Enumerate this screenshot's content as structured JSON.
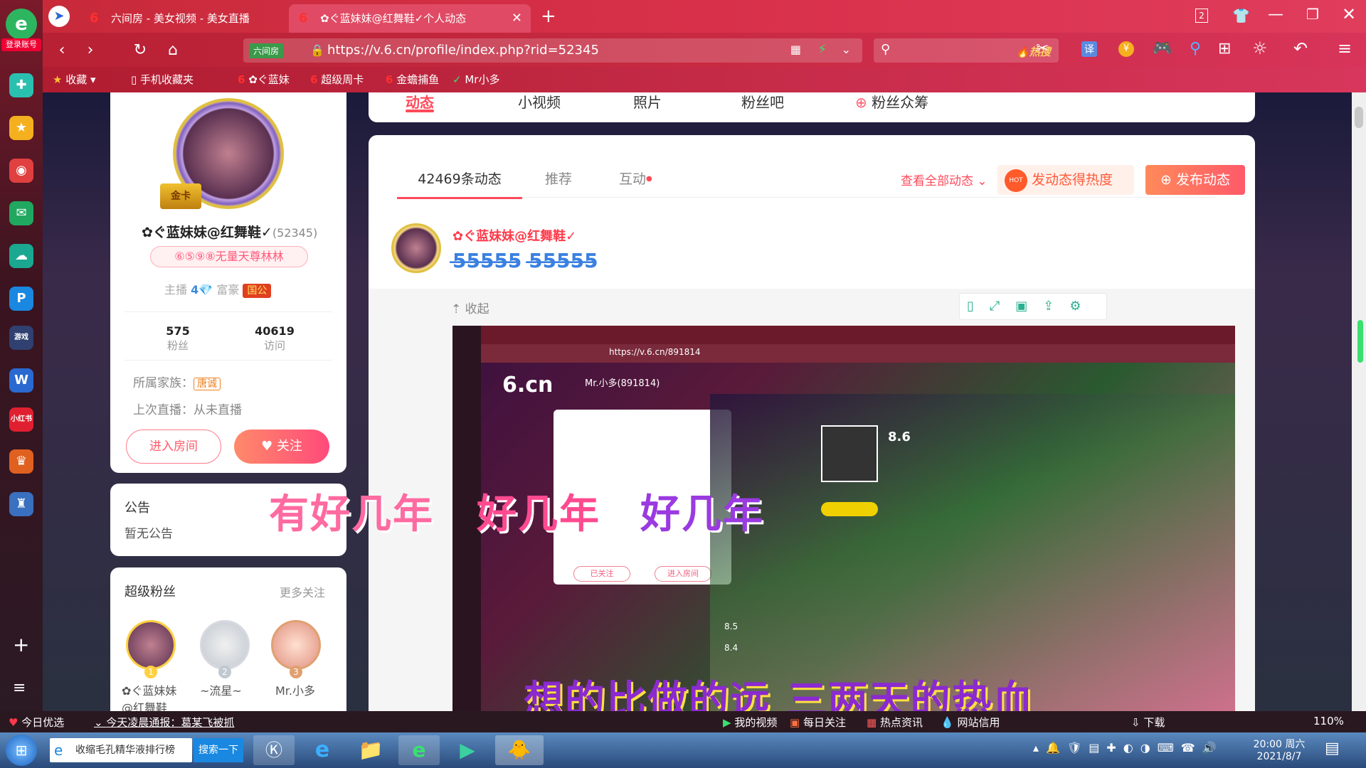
{
  "sidebar": {
    "login": "登录账号",
    "items": [
      "add-icon",
      "menu-icon"
    ]
  },
  "tabs": [
    {
      "label": "六间房 - 美女视频 - 美女直播",
      "active": false
    },
    {
      "label": "✿ぐ蓝妹妹@红舞鞋✓个人动态",
      "active": true
    }
  ],
  "address": {
    "tag": "六间房",
    "url": "https://v.6.cn/profile/index.php?rid=52345"
  },
  "search": {
    "hot": "热搜"
  },
  "toolbar": {
    "translate": "译"
  },
  "bookmarks": [
    "收藏",
    "手机收藏夹",
    "✿ぐ蓝妹",
    "超级周卡",
    "金蟾捕鱼",
    "Mr小多"
  ],
  "profile": {
    "name": "✿ぐ蓝妹妹@红舞鞋✓",
    "rid": "(52345)",
    "title": "⑥⑤⑨⑧无量天尊林林",
    "anchor_label": "主播",
    "anchor_level": "4",
    "rich_label": "富豪",
    "rich_badge": "国公",
    "fans_count": "575",
    "fans_label": "粉丝",
    "visits_count": "40619",
    "visits_label": "访问",
    "family_label": "所属家族：",
    "family": "唐诚",
    "last_live": "上次直播：从未直播",
    "enter_room": "进入房间",
    "follow": "关注",
    "frame_badge": "金卡"
  },
  "announcement": {
    "title": "公告",
    "text": "暂无公告"
  },
  "super_fans": {
    "title": "超级粉丝",
    "more": "更多关注",
    "fans": [
      {
        "rank": "1",
        "name": "✿ぐ蓝妹妹@红舞鞋"
      },
      {
        "rank": "2",
        "name": "~流星~"
      },
      {
        "rank": "3",
        "name": "Mr.小多"
      }
    ]
  },
  "top_tabs": [
    "动态",
    "小视频",
    "照片",
    "粉丝吧",
    "粉丝众筹"
  ],
  "feed": {
    "tabs": [
      "42469条动态",
      "推荐",
      "互动"
    ],
    "view_all": "查看全部动态",
    "heat_button": "发动态得热度",
    "hot_badge": "HOT",
    "post_button": "发布动态",
    "post_author": "✿ぐ蓝妹妹@红舞鞋✓",
    "post_body": "5̶5̶5̶5̶5̶ 5̶5̶5̶5̶5̶",
    "collapse": "收起"
  },
  "video": {
    "inner_url": "https://v.6.cn/891814",
    "inner_user": "Mr.小多",
    "inner_user_id": "(891814)",
    "rating1": "8.6",
    "rating2": "8.5",
    "rating3": "8.4",
    "follow_inner": "已关注",
    "enter_inner": "进入房间"
  },
  "subtitles": {
    "line1_a": "有好几年",
    "line1_b": "好几年",
    "line1_c": "好几年",
    "line2": "想的比做的远 三两天的热血"
  },
  "statusbar": {
    "news1": "今日优选",
    "news2": "今天凌晨通报：葛某飞被抓",
    "my_video": "我的视频",
    "daily": "每日关注",
    "hot_news": "热点资讯",
    "speed": "网站信用",
    "download": "下载",
    "zoom": "110%"
  },
  "taskbar": {
    "search_text": "收缩毛孔精华液排行榜",
    "search_btn": "搜索一下",
    "time": "20:00 周六",
    "date": "2021/8/7"
  },
  "colors": {
    "accent": "#ff4a5a",
    "tab_red": "#d8304a",
    "follow_pink": "#ff5a7a",
    "orange": "#ff7a4a"
  }
}
